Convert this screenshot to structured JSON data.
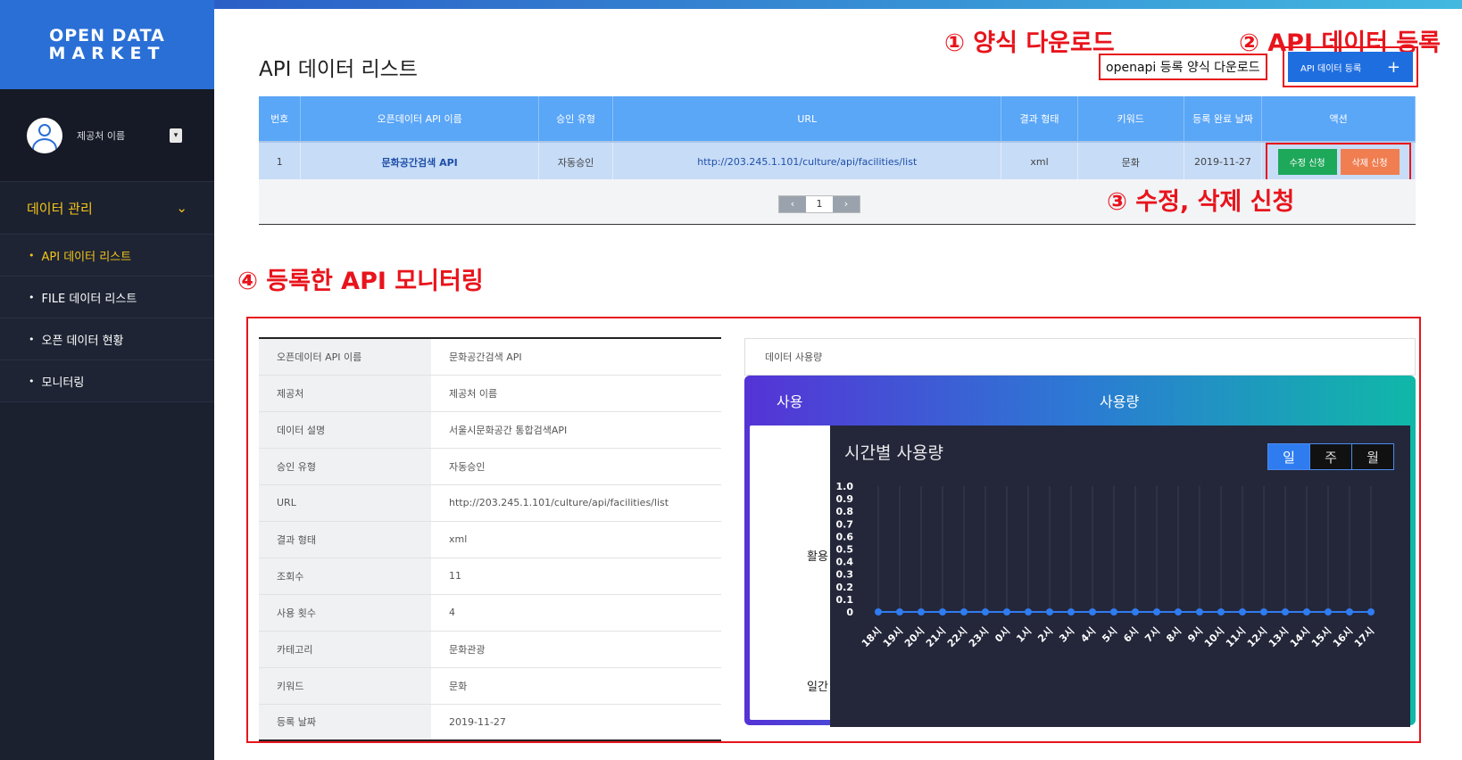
{
  "brand": {
    "line1": "OPEN DATA",
    "line2": "MARKET"
  },
  "profile": {
    "name": "제공처 이름",
    "dropdown_icon": "▾"
  },
  "sidebar": {
    "section": "데이터 관리",
    "section_icon": "chevron-down",
    "items": [
      {
        "label": "API 데이터 리스트",
        "active": true
      },
      {
        "label": "FILE 데이터 리스트",
        "active": false
      },
      {
        "label": "오픈 데이터 현황",
        "active": false
      },
      {
        "label": "모니터링",
        "active": false
      }
    ]
  },
  "page": {
    "title": "API 데이터 리스트"
  },
  "annotations": {
    "a1": "① 양식 다운로드",
    "a2": "② API 데이터 등록",
    "a3": "③ 수정, 삭제 신청",
    "a4": "④ 등록한 API 모니터링"
  },
  "toolbar": {
    "download_label": "openapi 등록 양식 다운로드",
    "register_label": "API 데이터 등록",
    "register_icon": "+"
  },
  "table": {
    "headers": [
      "번호",
      "오픈데이터 API 이름",
      "승인 유형",
      "URL",
      "결과 형태",
      "키워드",
      "등록 완료 날짜",
      "액션"
    ],
    "rows": [
      {
        "no": "1",
        "name": "문화공간검색 API",
        "approval": "자동승인",
        "url": "http://203.245.1.101/culture/api/facilities/list",
        "format": "xml",
        "keyword": "문화",
        "date": "2019-11-27",
        "edit": "수정 신청",
        "delete": "삭제 신청"
      }
    ]
  },
  "pagination": {
    "prev": "‹",
    "current": "1",
    "next": "›"
  },
  "detail": [
    {
      "key": "오픈데이터 API 이름",
      "value": "문화공간검색 API"
    },
    {
      "key": "제공처",
      "value": "제공처 이름"
    },
    {
      "key": "데이터 설명",
      "value": "서울시문화공간 통합검색API"
    },
    {
      "key": "승인 유형",
      "value": "자동승인"
    },
    {
      "key": "URL",
      "value": "http://203.245.1.101/culture/api/facilities/list"
    },
    {
      "key": "결과 형태",
      "value": "xml"
    },
    {
      "key": "조회수",
      "value": "11"
    },
    {
      "key": "사용 횟수",
      "value": "4"
    },
    {
      "key": "카테고리",
      "value": "문화관광"
    },
    {
      "key": "키워드",
      "value": "문화"
    },
    {
      "key": "등록 날짜",
      "value": "2019-11-27"
    }
  ],
  "usage": {
    "label": "데이터 사용량",
    "card_left": "사용",
    "card_title": "사용량",
    "side1": "활용 ",
    "side2": "일간",
    "chart_title": "시간별 사용량",
    "toggles": [
      {
        "label": "일",
        "on": true
      },
      {
        "label": "주",
        "on": false
      },
      {
        "label": "월",
        "on": false
      }
    ]
  },
  "chart_data": {
    "type": "line",
    "title": "시간별 사용량",
    "categories": [
      "18시",
      "19시",
      "20시",
      "21시",
      "22시",
      "23시",
      "0시",
      "1시",
      "2시",
      "3시",
      "4시",
      "5시",
      "6시",
      "7시",
      "8시",
      "9시",
      "10시",
      "11시",
      "12시",
      "13시",
      "14시",
      "15시",
      "16시",
      "17시"
    ],
    "values": [
      0,
      0,
      0,
      0,
      0,
      0,
      0,
      0,
      0,
      0,
      0,
      0,
      0,
      0,
      0,
      0,
      0,
      0,
      0,
      0,
      0,
      0,
      0,
      0
    ],
    "ylim": [
      0,
      1
    ],
    "yticks": [
      "1.0",
      "0.9",
      "0.8",
      "0.7",
      "0.6",
      "0.5",
      "0.4",
      "0.3",
      "0.2",
      "0.1",
      "0"
    ],
    "grid": true,
    "colors": {
      "line": "#2f7cf0",
      "point": "#2f7cf0"
    }
  }
}
